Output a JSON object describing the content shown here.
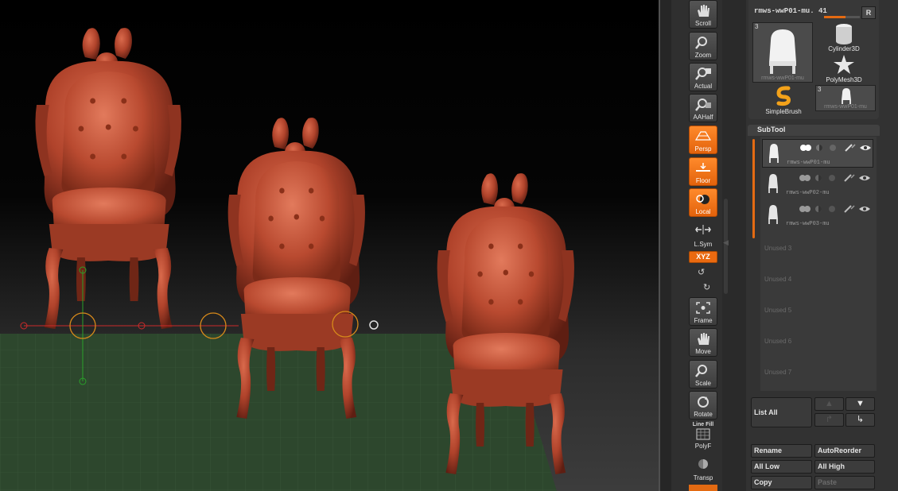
{
  "shelf": {
    "buttons": [
      {
        "id": "scroll",
        "label": "Scroll",
        "icon": "hand-icon",
        "active": false
      },
      {
        "id": "zoom",
        "label": "Zoom",
        "icon": "magnifier-icon",
        "active": false
      },
      {
        "id": "actual",
        "label": "Actual",
        "icon": "magnifier-icon",
        "active": false
      },
      {
        "id": "aahalf",
        "label": "AAHalf",
        "icon": "magnifier-icon",
        "active": false
      },
      {
        "id": "persp",
        "label": "Persp",
        "icon": "perspective-icon",
        "active": true
      },
      {
        "id": "floor",
        "label": "Floor",
        "icon": "floor-icon",
        "active": true
      },
      {
        "id": "local",
        "label": "Local",
        "icon": "local-icon",
        "active": true
      },
      {
        "id": "lsym",
        "label": "L.Sym",
        "icon": "symmetry-icon",
        "active": false
      },
      {
        "id": "frame",
        "label": "Frame",
        "icon": "frame-icon",
        "active": false
      },
      {
        "id": "move",
        "label": "Move",
        "icon": "hand-icon",
        "active": false
      },
      {
        "id": "scale",
        "label": "Scale",
        "icon": "magnifier-icon",
        "active": false
      },
      {
        "id": "rotate",
        "label": "Rotate",
        "icon": "rotate-icon",
        "active": false
      },
      {
        "id": "polyf",
        "label": "PolyF",
        "icon": "polyframe-icon",
        "active": false
      },
      {
        "id": "transp",
        "label": "Transp",
        "icon": "transparency-icon",
        "active": false
      }
    ],
    "xyz_label": "XYZ",
    "linefill_label": "Line Fill"
  },
  "tool": {
    "name": "rmws-wwP01-mu. 41",
    "r_label": "R",
    "thumb_count": "3",
    "thumb_caption": "rmws-wwP01-mu",
    "items": [
      {
        "label": "Cylinder3D",
        "icon": "cylinder-icon"
      },
      {
        "label": "PolyMesh3D",
        "icon": "star-icon"
      },
      {
        "label": "SimpleBrush",
        "icon": "simplebrush-icon"
      }
    ],
    "small_thumb_count": "3",
    "small_thumb_caption": "rmws-wwP01-mu"
  },
  "subtool": {
    "header": "SubTool",
    "rows": [
      {
        "name": "rmws-wwP01-mu",
        "selected": true
      },
      {
        "name": "rmws-wwP02-mu",
        "selected": false
      },
      {
        "name": "rmws-wwP03-mu",
        "selected": false
      }
    ],
    "unused": [
      "Unused 3",
      "Unused 4",
      "Unused 5",
      "Unused 6",
      "Unused 7"
    ],
    "list_all": "List All",
    "buttons": {
      "rename": "Rename",
      "autoreorder": "AutoReorder",
      "all_low": "All Low",
      "all_high": "All High",
      "copy": "Copy",
      "paste": "Paste"
    }
  },
  "colors": {
    "accent": "#e36a12",
    "model": "#b8442a",
    "floor_grid": "#2f4a2f"
  }
}
